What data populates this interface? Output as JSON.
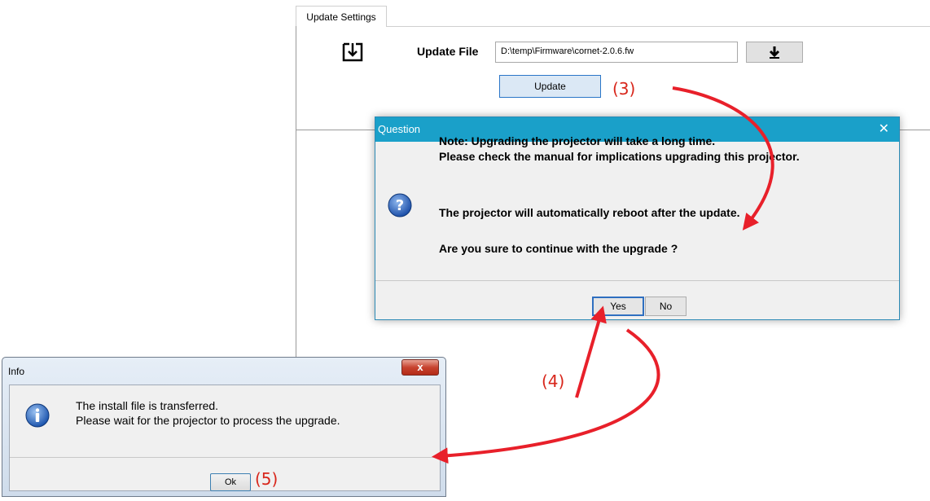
{
  "settings": {
    "tab_label": "Update Settings",
    "update_file_label": "Update File",
    "file_path": "D:\\temp\\Firmware\\cornet-2.0.6.fw",
    "update_button": "Update"
  },
  "question_dialog": {
    "title": "Question",
    "close_glyph": "✕",
    "lines": [
      "Note: Upgrading the projector will take a long time.",
      "Please check the manual for implications upgrading this projector.",
      "The projector will automatically reboot after the update.",
      "Are you sure to continue with the upgrade ?"
    ],
    "yes_label": "Yes",
    "no_label": "No"
  },
  "info_dialog": {
    "title": "Info",
    "close_glyph": "x",
    "lines": [
      "The install file is transferred.",
      "Please wait for the projector to process the upgrade."
    ],
    "ok_label": "Ok"
  },
  "annotations": {
    "step3": "(3)",
    "step4": "(4)",
    "step5": "(5)",
    "color": "#d8261b"
  },
  "colors": {
    "question_title_bar": "#1aa0c9",
    "info_close": "#c7432f"
  },
  "icons": {
    "file": "import-file-icon",
    "download": "download-arrow-icon",
    "question": "question-icon",
    "info": "info-icon"
  }
}
